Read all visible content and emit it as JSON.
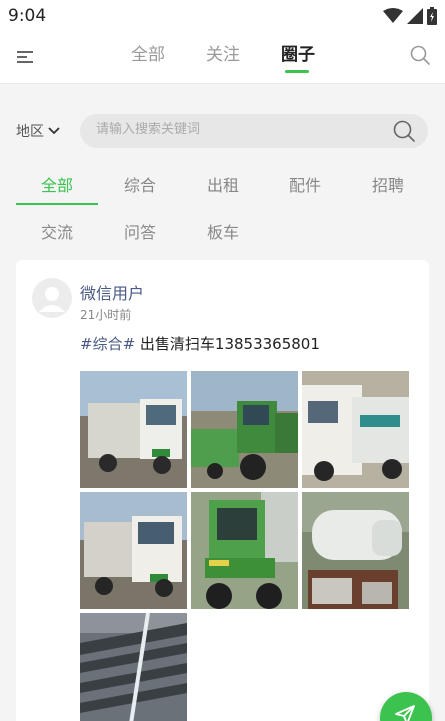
{
  "status_bar": {
    "time": "9:04"
  },
  "top_nav": {
    "tabs": [
      {
        "label": "全部",
        "active": false
      },
      {
        "label": "关注",
        "active": false
      },
      {
        "label": "圈子",
        "active": true
      }
    ]
  },
  "filter": {
    "region_label": "地区",
    "search_placeholder": "请输入搜索关键词"
  },
  "categories": [
    {
      "label": "全部",
      "active": true
    },
    {
      "label": "综合",
      "active": false
    },
    {
      "label": "出租",
      "active": false
    },
    {
      "label": "配件",
      "active": false
    },
    {
      "label": "招聘",
      "active": false
    },
    {
      "label": "交流",
      "active": false
    },
    {
      "label": "问答",
      "active": false
    },
    {
      "label": "板车",
      "active": false
    }
  ],
  "post": {
    "user_name": "微信用户",
    "time_ago": "21小时前",
    "tag": "#综合#",
    "text": " 出售清扫车13853365801",
    "photo_count": 7
  },
  "colors": {
    "accent": "#3cc24f",
    "username": "#4a5a86"
  },
  "icons": {
    "menu": "menu-icon",
    "search": "search-icon",
    "chevron": "chevron-down-icon",
    "fab": "paper-plane-icon"
  }
}
